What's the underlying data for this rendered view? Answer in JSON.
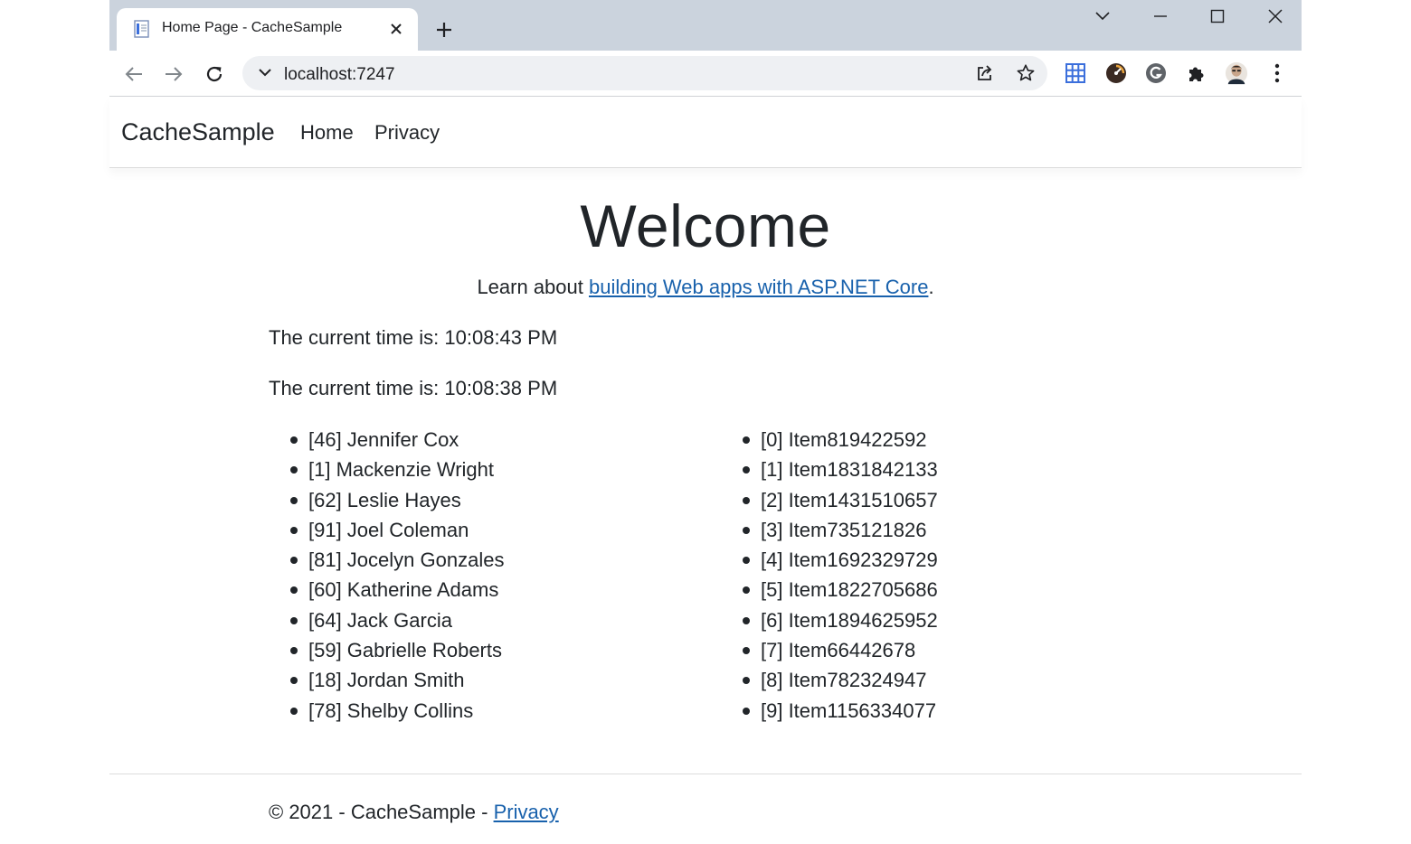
{
  "browser": {
    "tab_title": "Home Page - CacheSample",
    "url": "localhost:7247",
    "icons": [
      "favicon-icon",
      "close-icon",
      "plus-icon",
      "chevron-down-icon",
      "minimize-icon",
      "maximize-icon",
      "close-window-icon",
      "back-arrow-icon",
      "forward-arrow-icon",
      "reload-icon",
      "share-icon",
      "star-icon",
      "grid-extension-icon",
      "speed-extension-icon",
      "grammarly-icon",
      "puzzle-icon",
      "profile-avatar",
      "kebab-menu-icon"
    ],
    "colors": {
      "tabstrip": "#cbd3dd",
      "omnibox": "#eef0f3",
      "grid_extension": "#3b6fdc"
    }
  },
  "navbar": {
    "brand": "CacheSample",
    "links": [
      "Home",
      "Privacy"
    ]
  },
  "main": {
    "heading": "Welcome",
    "learn_prefix": "Learn about ",
    "learn_link": "building Web apps with ASP.NET Core",
    "learn_suffix": ".",
    "times": [
      "The current time is: 10:08:43 PM",
      "The current time is: 10:08:38 PM"
    ],
    "people": [
      "[46] Jennifer Cox",
      "[1] Mackenzie Wright",
      "[62] Leslie Hayes",
      "[91] Joel Coleman",
      "[81] Jocelyn Gonzales",
      "[60] Katherine Adams",
      "[64] Jack Garcia",
      "[59] Gabrielle Roberts",
      "[18] Jordan Smith",
      "[78] Shelby Collins"
    ],
    "items": [
      "[0] Item819422592",
      "[1] Item1831842133",
      "[2] Item1431510657",
      "[3] Item735121826",
      "[4] Item1692329729",
      "[5] Item1822705686",
      "[6] Item1894625952",
      "[7] Item66442678",
      "[8] Item782324947",
      "[9] Item1156334077"
    ],
    "link_color": "#1861ac"
  },
  "footer": {
    "text": "© 2021 - CacheSample - ",
    "link": "Privacy"
  }
}
